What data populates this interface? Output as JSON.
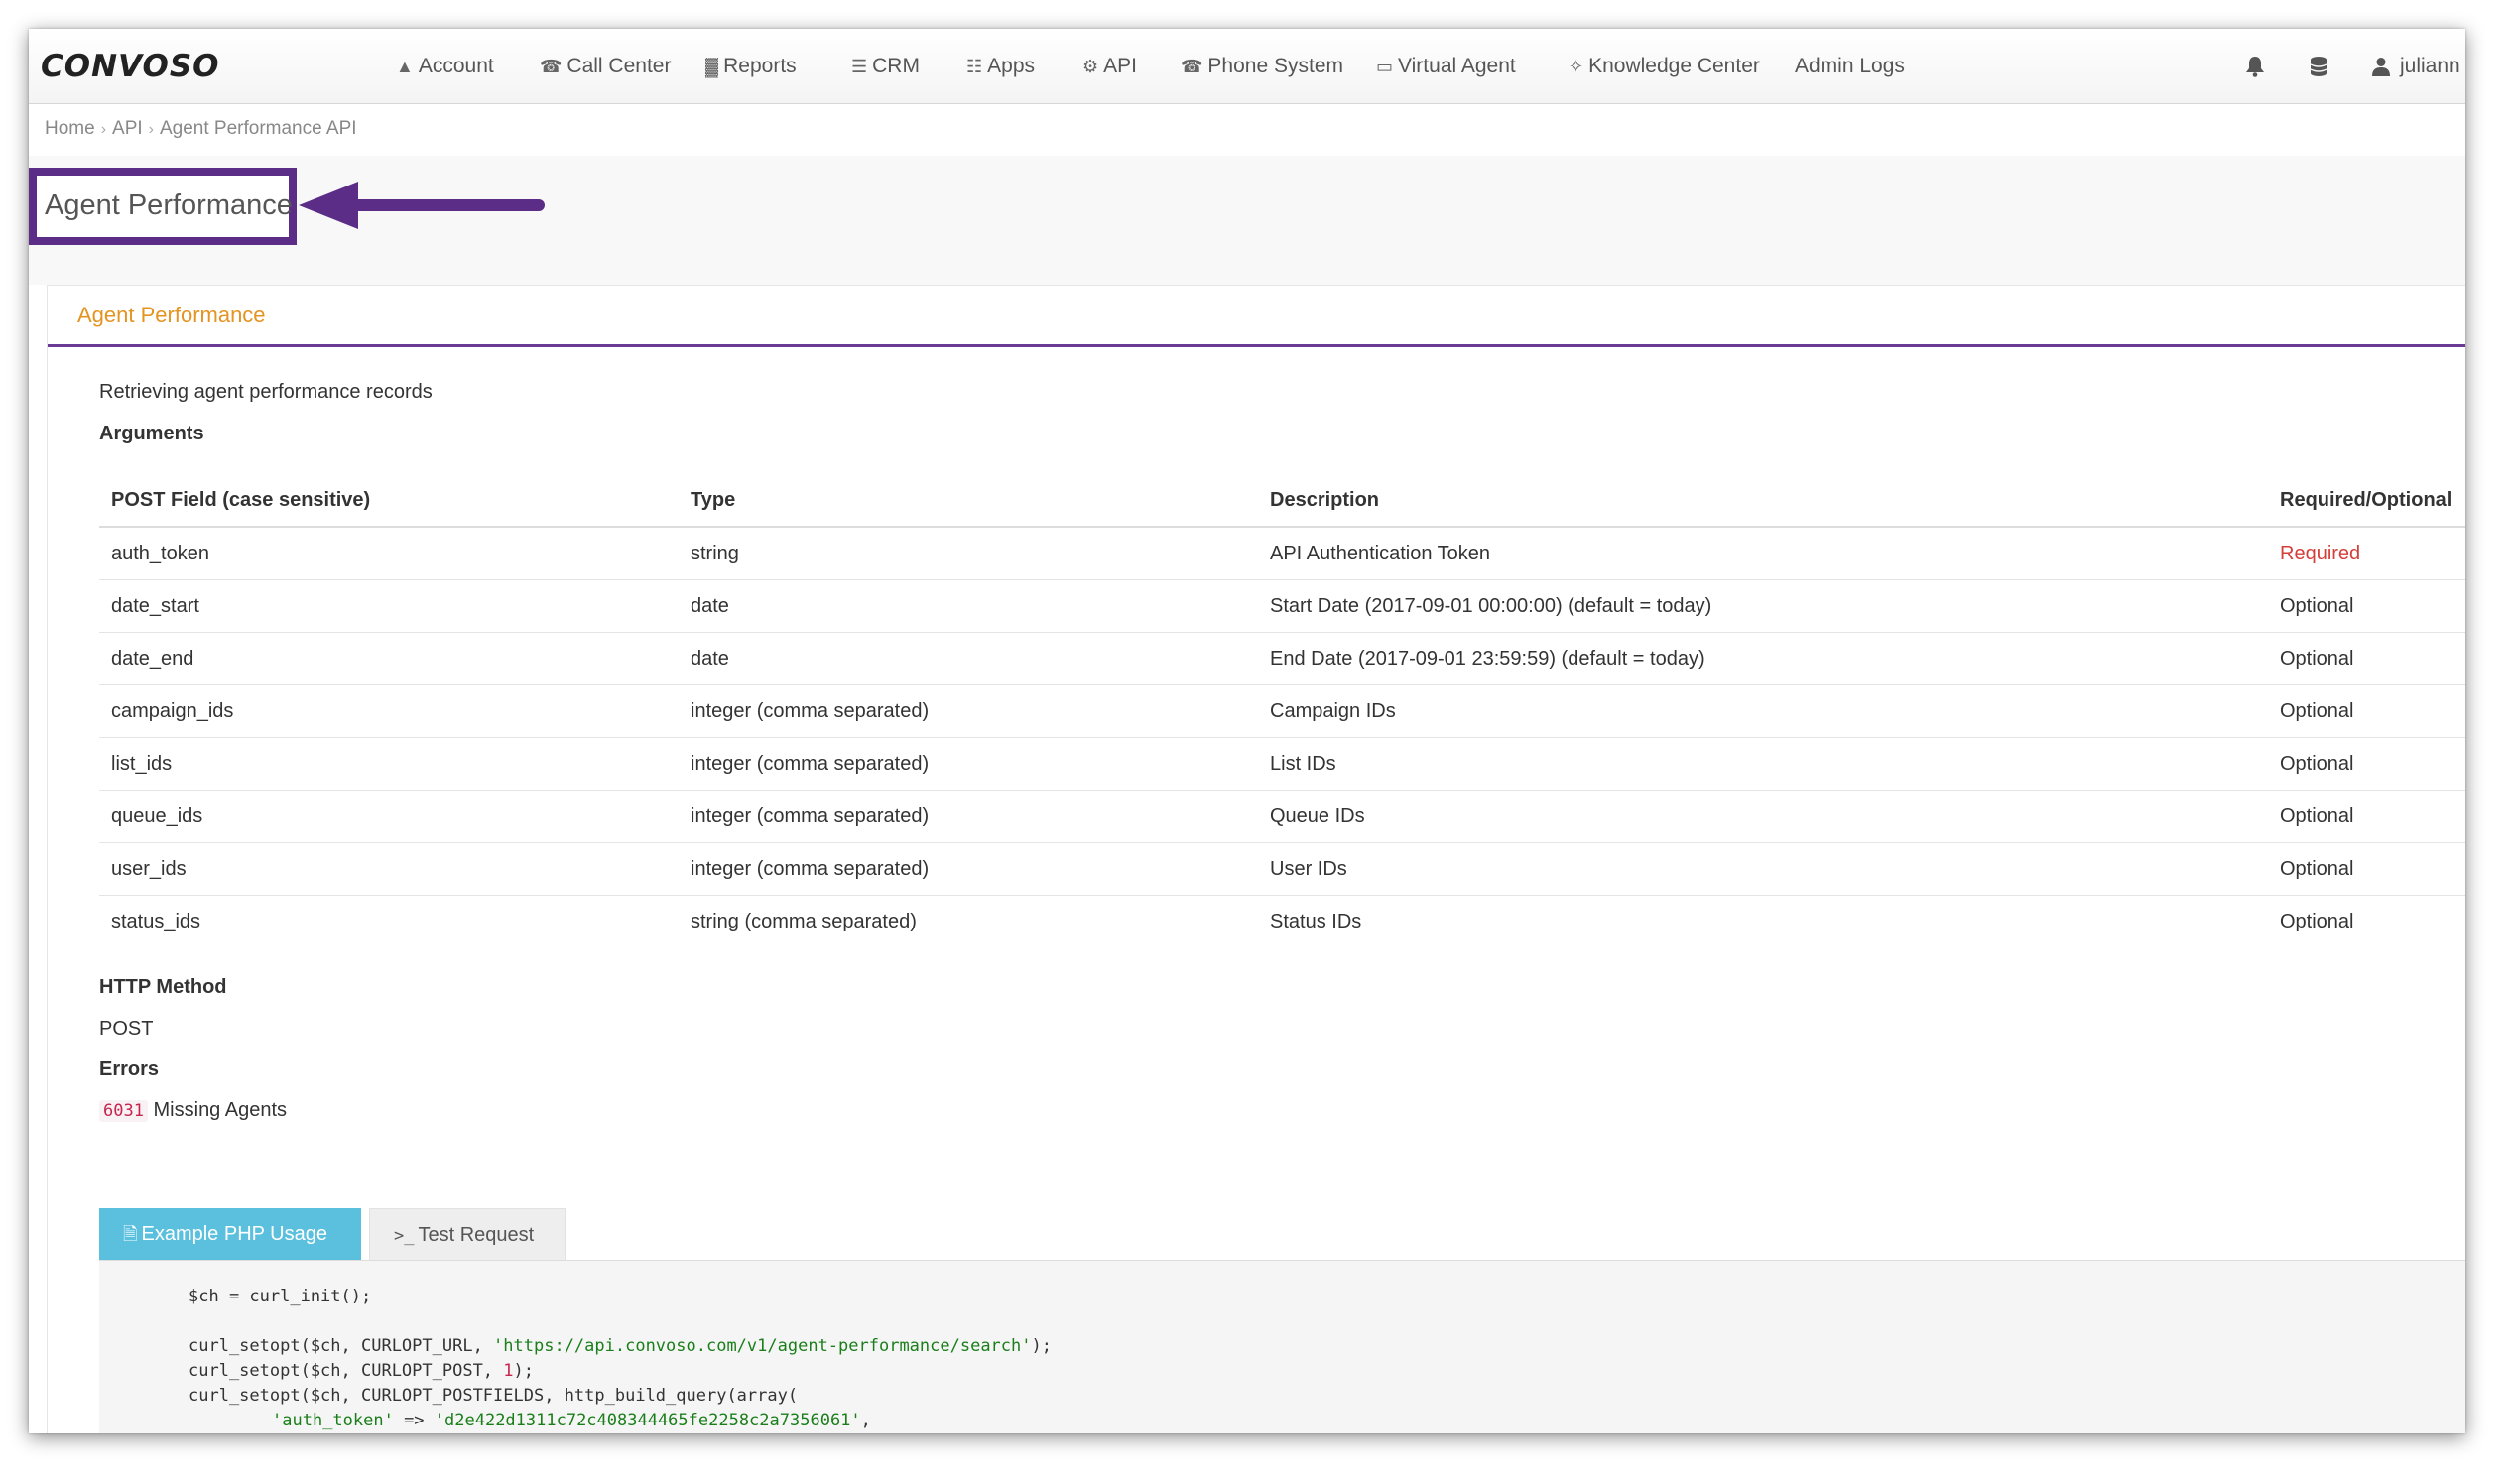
{
  "navbar": {
    "logo": "CONVOSO",
    "items": [
      {
        "label": "Account",
        "icon": "user-icon",
        "glyph": "▲"
      },
      {
        "label": "Call Center",
        "icon": "phone-icon",
        "glyph": "☎"
      },
      {
        "label": "Reports",
        "icon": "bar-chart-icon",
        "glyph": "▓"
      },
      {
        "label": "CRM",
        "icon": "list-icon",
        "glyph": "☰"
      },
      {
        "label": "Apps",
        "icon": "grid-icon",
        "glyph": "☷"
      },
      {
        "label": "API",
        "icon": "gear-icon",
        "glyph": "⚙"
      },
      {
        "label": "Phone System",
        "icon": "phone-icon",
        "glyph": "☎"
      },
      {
        "label": "Virtual Agent",
        "icon": "monitor-icon",
        "glyph": "▭"
      },
      {
        "label": "Knowledge Center",
        "icon": "lightbulb-icon",
        "glyph": "✧"
      },
      {
        "label": "Admin Logs",
        "icon": "",
        "glyph": ""
      }
    ],
    "right": {
      "bell_icon": "bell-icon",
      "database_icon": "database-icon",
      "user_icon": "user-icon",
      "username": "juliann"
    }
  },
  "breadcrumb": [
    "Home",
    "API",
    "Agent Performance API"
  ],
  "page_title": "Agent Performance",
  "panel": {
    "title": "Agent Performance",
    "intro": "Retrieving agent performance records",
    "arguments_heading": "Arguments",
    "columns": [
      "POST Field (case sensitive)",
      "Type",
      "Description",
      "Required/Optional"
    ],
    "rows": [
      [
        "auth_token",
        "string",
        "API Authentication Token",
        "Required"
      ],
      [
        "date_start",
        "date",
        "Start Date (2017-09-01 00:00:00) (default = today)",
        "Optional"
      ],
      [
        "date_end",
        "date",
        "End Date (2017-09-01 23:59:59) (default = today)",
        "Optional"
      ],
      [
        "campaign_ids",
        "integer (comma separated)",
        "Campaign IDs",
        "Optional"
      ],
      [
        "list_ids",
        "integer (comma separated)",
        "List IDs",
        "Optional"
      ],
      [
        "queue_ids",
        "integer (comma separated)",
        "Queue IDs",
        "Optional"
      ],
      [
        "user_ids",
        "integer (comma separated)",
        "User IDs",
        "Optional"
      ],
      [
        "status_ids",
        "string (comma separated)",
        "Status IDs",
        "Optional"
      ]
    ],
    "http_method_heading": "HTTP Method",
    "http_method": "POST",
    "errors_heading": "Errors",
    "error_code": "6031",
    "error_text": "Missing Agents"
  },
  "tabs": [
    {
      "label": "Example PHP Usage",
      "icon": "file-code-icon",
      "active": true
    },
    {
      "label": "Test Request",
      "icon": "terminal-icon",
      "active": false
    }
  ],
  "code": {
    "l1": "$ch = curl_init();",
    "l2a": "curl_setopt($ch, CURLOPT_URL, ",
    "l2s": "'https://api.convoso.com/v1/agent-performance/search'",
    "l2b": ");",
    "l3a": "curl_setopt($ch, CURLOPT_POST, ",
    "l3n": "1",
    "l3b": ");",
    "l4": "curl_setopt($ch, CURLOPT_POSTFIELDS, http_build_query(array(",
    "l5k": "'auth_token'",
    "l5m": " => ",
    "l5v": "'d2e422d1311c72c408344465fe2258c2a7356061'",
    "l5e": ",",
    "l6": ")));"
  },
  "colors": {
    "highlight": "#5b2d86",
    "panel_title": "#e49421",
    "required": "#d43f3a",
    "active_tab": "#5bc0de"
  }
}
